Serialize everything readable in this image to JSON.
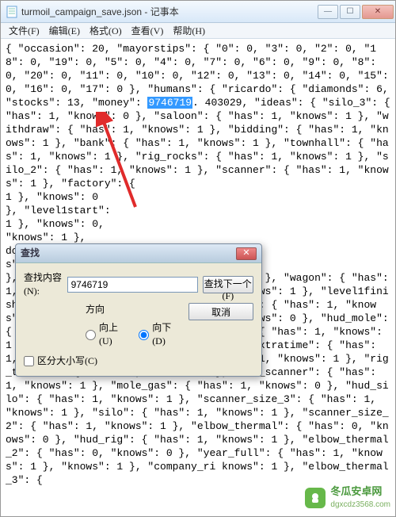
{
  "window": {
    "title": "turmoil_campaign_save.json - 记事本",
    "min_icon": "—",
    "max_icon": "☐",
    "close_icon": "✕"
  },
  "menu": {
    "file": "文件(F)",
    "edit": "编辑(E)",
    "format": "格式(O)",
    "view": "查看(V)",
    "help": "帮助(H)"
  },
  "body": {
    "pre": "{ \"occasion\": 20, \"mayorstips\": { \"0\": 0, \"3\": 0, \"2\": 0, \"18\": 0, \"19\": 0, \"5\": 0, \"4\": 0, \"7\": 0, \"6\": 0, \"9\": 0, \"8\": 0, \"20\": 0, \"11\": 0, \"10\": 0, \"12\": 0, \"13\": 0, \"14\": 0, \"15\": 0, \"16\": 0, \"17\": 0 }, \"humans\": { \"ricardo\": { \"diamonds\": 6, \"stocks\": 13, \"money\": ",
    "highlight": "9746719",
    "post": ". 403029, \"ideas\": { \"silo_3\": { \"has\": 1, \"knows\": 0 }, \"saloon\": { \"has\": 1, \"knows\": 1 }, \"withdraw\": { \"has\": 1, \"knows\": 1 }, \"bidding\": { \"has\": 1, \"knows\": 1 }, \"bank\": { \"has\": 1, \"knows\": 1 }, \"townhall\": { \"has\": 1, \"knows\": 1 }, \"rig_rocks\": { \"has\": 1, \"knows\": 1 }, \"silo_2\": { \"has\": 1, \"knows\": 1 }, \"scanner\": { \"has\": 1, \"knows\": 1 }, \"factory\": { ",
    "mid1": "1 }, \"knows\": 0 ",
    "mid2": "}, \"level1start\": ",
    "mid3": "1 }, \"knows\": 0, ",
    "mid4": "\"knows\": 1 }, ",
    "mid5": "dowser\": { ",
    "mid6": "s\": 1, \"knows\": 1 ",
    "post2": "}, \"company_left\": { \"has\": 1, \"knows\": 0 }, \"wagon\": { \"has\": 1, \"knows\": 1 }, \"loan\": { \"has\": 1, \"knows\": 1 }, \"level1finish\": { \"has\": 1, \"knows\": 1 }, \"spillage\": { \"has\": 1, \"knows\": 1 }, \"year_quarter\": { \"has\": 1, \"knows\": 0 }, \"hud_mole\": { \"has\": 1, \"knows\": 1 }, \"level2start\": { \"has\": 1, \"knows\": 1 }, \"rock\": { \"has\": 1, \"knows\": 0 }, \"extratime\": { \"has\": 1, \"knows\": 1 }, \"rig_timer_3\": { \"has\": 1, \"knows\": 1 }, \"rig_timer_2\": { \"has\": 1, \"knows\": 1 }, \"hud_scanner\": { \"has\": 1, \"knows\": 1 }, \"mole_gas\": { \"has\": 1, \"knows\": 0 }, \"hud_silo\": { \"has\": 1, \"knows\": 1 }, \"scanner_size_3\": { \"has\": 1, \"knows\": 1 }, \"silo\": { \"has\": 1, \"knows\": 1 }, \"scanner_size_2\": { \"has\": 1, \"knows\": 1 }, \"elbow_thermal\": { \"has\": 0, \"knows\": 0 }, \"hud_rig\": { \"has\": 1, \"knows\": 1 }, \"elbow_thermal_2\": { \"has\": 0, \"knows\": 0 }, \"year_full\": { \"has\": 1, \"knows\": 1 }, \"knows\": 1 }, \"company_ri\nknows\": 1 }, \"elbow_thermal_3\": {"
  },
  "find": {
    "title": "查找",
    "label": "查找内容(N):",
    "value": "9746719",
    "next": "查找下一个(F)",
    "cancel": "取消",
    "direction": "方向",
    "up": "向上(U)",
    "down": "向下(D)",
    "matchcase": "区分大小写(C)"
  },
  "watermark": {
    "name": "冬瓜安卓网",
    "url": "dgxcdz3568.com"
  }
}
